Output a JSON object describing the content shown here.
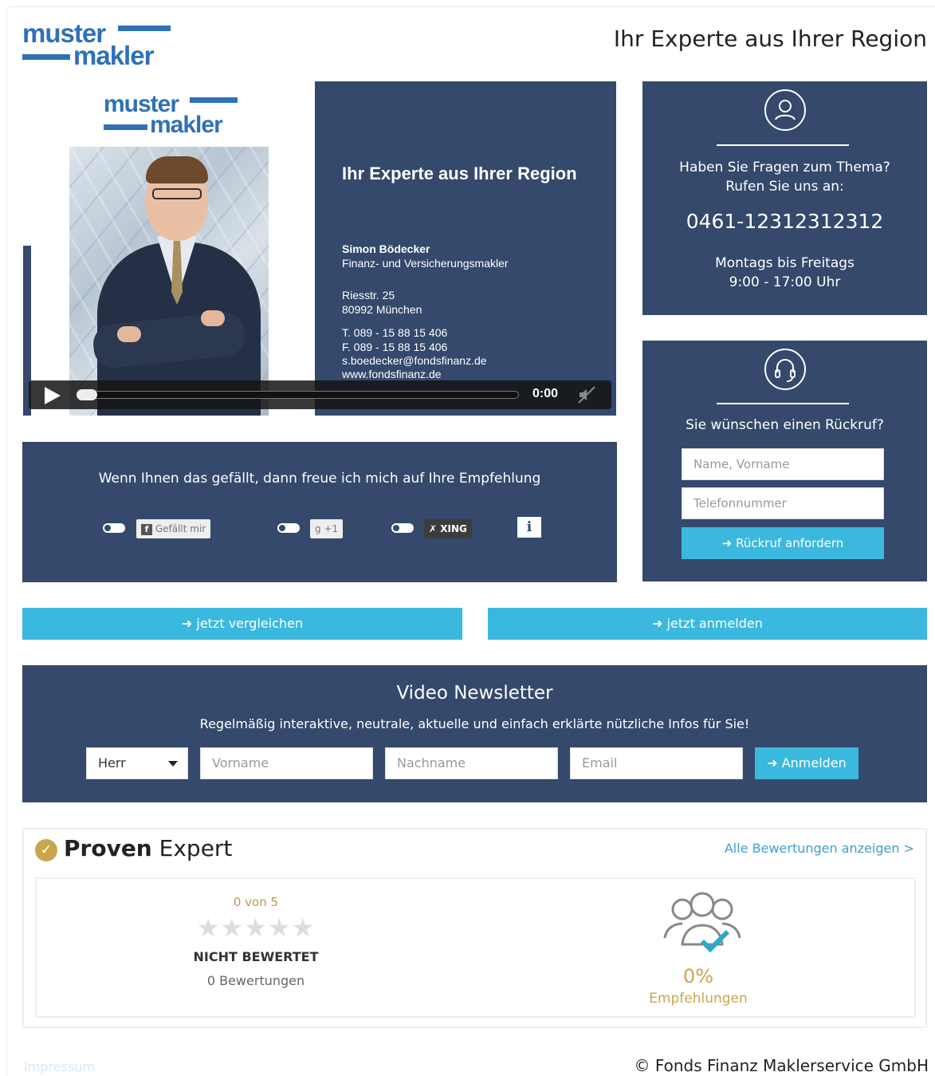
{
  "header": {
    "logo_line1": "muster",
    "logo_line2": "makler",
    "title": "Ihr Experte aus Ihrer Region"
  },
  "video": {
    "logo_line1": "muster",
    "logo_line2": "makler",
    "headline": "Ihr Experte aus Ihrer Region",
    "name": "Simon Bödecker",
    "role": "Finanz- und Versicherungsmakler",
    "street": "Riesstr. 25",
    "city": "80992 München",
    "phone": "T. 089 - 15 88 15 406",
    "fax": "F. 089 - 15 88 15 406",
    "email": "s.boedecker@fondsfinanz.de",
    "web": "www.fondsfinanz.de",
    "time": "0:00",
    "progress": 0
  },
  "contact": {
    "question_line1": "Haben Sie Fragen zum Thema?",
    "question_line2": "Rufen Sie uns an:",
    "phone": "0461-12312312312",
    "hours_line1": "Montags bis Freitags",
    "hours_line2": "9:00 - 17:00 Uhr",
    "icon": "user-icon"
  },
  "callback": {
    "icon": "headset-icon",
    "title": "Sie wünschen einen Rückruf?",
    "name_placeholder": "Name, Vorname",
    "phone_placeholder": "Telefonnummer",
    "button": "➜ Rückruf anfordern"
  },
  "recommend": {
    "title": "Wenn Ihnen das gefällt, dann freue ich mich auf Ihre Empfehlung",
    "facebook": "Gefällt mir",
    "facebook_icon": "f",
    "gplus": "+1",
    "gplus_icon": "g",
    "xing": "XING",
    "xing_icon": "✗",
    "info": "i"
  },
  "cta": {
    "compare": "➜ jetzt vergleichen",
    "register": "➜ jetzt anmelden"
  },
  "newsletter": {
    "title": "Video Newsletter",
    "subtitle": "Regelmäßig interaktive, neutrale, aktuelle und einfach erklärte nützliche Infos für Sie!",
    "salutation": "Herr",
    "firstname_placeholder": "Vorname",
    "lastname_placeholder": "Nachname",
    "email_placeholder": "Email",
    "button": "➜ Anmelden"
  },
  "proven_expert": {
    "badge": "✓",
    "brand_bold": "Proven",
    "brand_light": "Expert",
    "all_reviews": "Alle Bewertungen anzeigen >",
    "score": "0 von 5",
    "stars": "★★★★★",
    "rating": 0,
    "not_rated": "NICHT BEWERTET",
    "reviews_count": "0 Bewertungen",
    "percent": "0%",
    "recommendations": "Empfehlungen"
  },
  "footer": {
    "imprint": "Impressum",
    "copyright": "© Fonds Finanz Maklerservice GmbH"
  },
  "colors": {
    "navy": "#34496b",
    "cyan": "#3bb8dd",
    "logo_blue": "#2f70b8",
    "gold": "#c9a64d"
  }
}
